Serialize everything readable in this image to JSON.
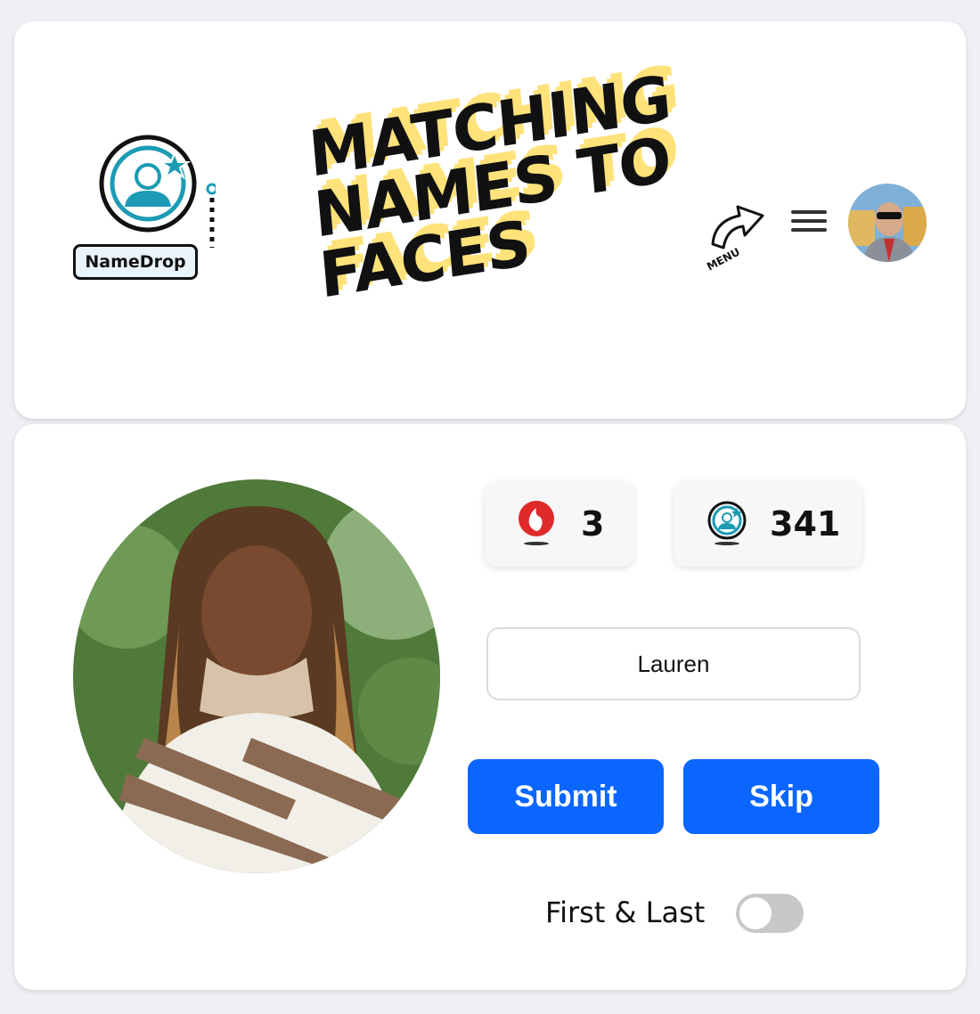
{
  "logo": {
    "brand_label": "NameDrop",
    "icon": "namedrop-face-icon"
  },
  "header": {
    "headline_lines": [
      "MATCHING",
      "NAMES TO",
      "FACES"
    ],
    "menu_hint_label": "MENU",
    "menu_icon": "hamburger-menu-icon",
    "profile_avatar": "user-avatar"
  },
  "quiz": {
    "portrait": "person-portrait-photo",
    "streak": {
      "icon": "flame-icon",
      "value": "3"
    },
    "total": {
      "icon": "namedrop-face-icon",
      "value": "341"
    },
    "name_input": {
      "value": "Lauren",
      "placeholder": ""
    },
    "submit_label": "Submit",
    "skip_label": "Skip",
    "toggle": {
      "label": "First & Last",
      "enabled": false
    }
  },
  "colors": {
    "accent": "#0a66ff",
    "teal": "#1b9bb4",
    "highlight": "#ffe27a",
    "flame": "#e02a2a"
  }
}
